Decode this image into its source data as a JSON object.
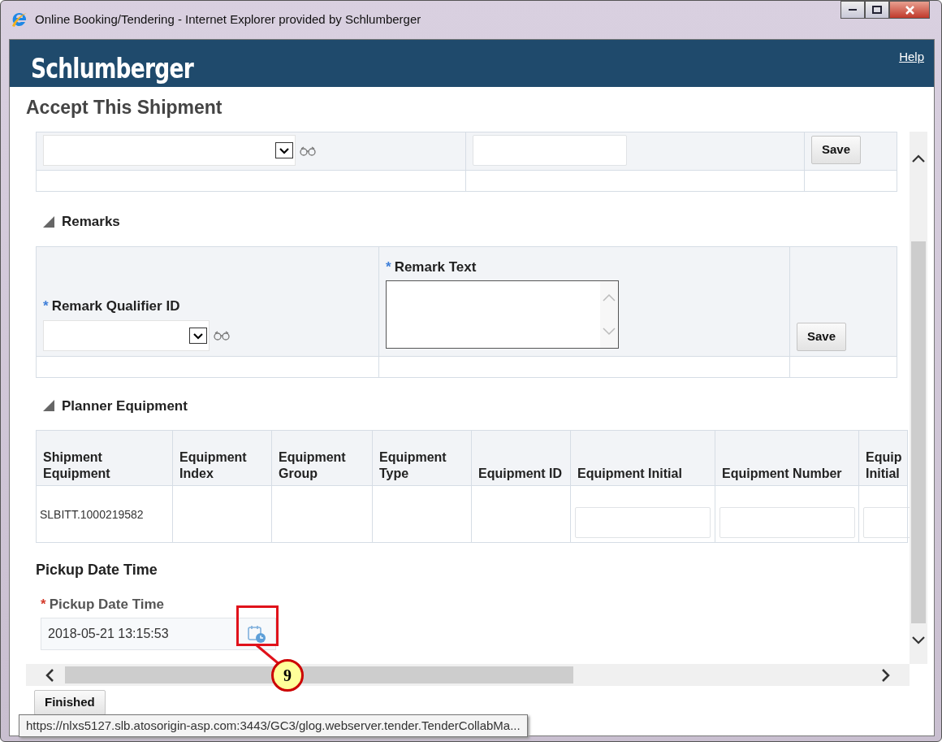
{
  "window": {
    "title": "Online Booking/Tendering - Internet Explorer provided by Schlumberger"
  },
  "header": {
    "logo": "Schlumberger",
    "help_link": "Help"
  },
  "page_title": "Accept This Shipment",
  "top_row": {
    "save_button": "Save"
  },
  "remarks": {
    "title": "Remarks",
    "expanded": true,
    "fields": [
      {
        "kind": "select",
        "label": "Remark Qualifier ID",
        "required_mark": "*"
      },
      {
        "kind": "textarea",
        "label": "Remark Text",
        "required_mark": "*"
      }
    ],
    "save_button": "Save"
  },
  "planner_equipment": {
    "title": "Planner Equipment",
    "expanded": true,
    "columns": [
      {
        "label": "Shipment Equipment",
        "kind": "text"
      },
      {
        "label": "Equipment Index",
        "kind": "text"
      },
      {
        "label": "Equipment Group",
        "kind": "text"
      },
      {
        "label": "Equipment Type",
        "kind": "text"
      },
      {
        "label": "Equipment ID",
        "kind": "text"
      },
      {
        "label": "Equipment Initial",
        "kind": "input"
      },
      {
        "label": "Equipment Number",
        "kind": "input"
      },
      {
        "label": "Equip Initial",
        "kind": "input"
      }
    ],
    "rows": [
      {
        "shipment_equipment": "SLBITT.1000219582"
      }
    ]
  },
  "pickup": {
    "section_title": "Pickup Date Time",
    "label": "Pickup Date Time",
    "required_mark": "*",
    "value": "2018-05-21 13:15:53"
  },
  "finished_button": "Finished",
  "status_url": "https://nlxs5127.slb.atosorigin-asp.com:3443/GC3/glog.webserver.tender.TenderCollabMa...",
  "callout": {
    "label": "9"
  }
}
